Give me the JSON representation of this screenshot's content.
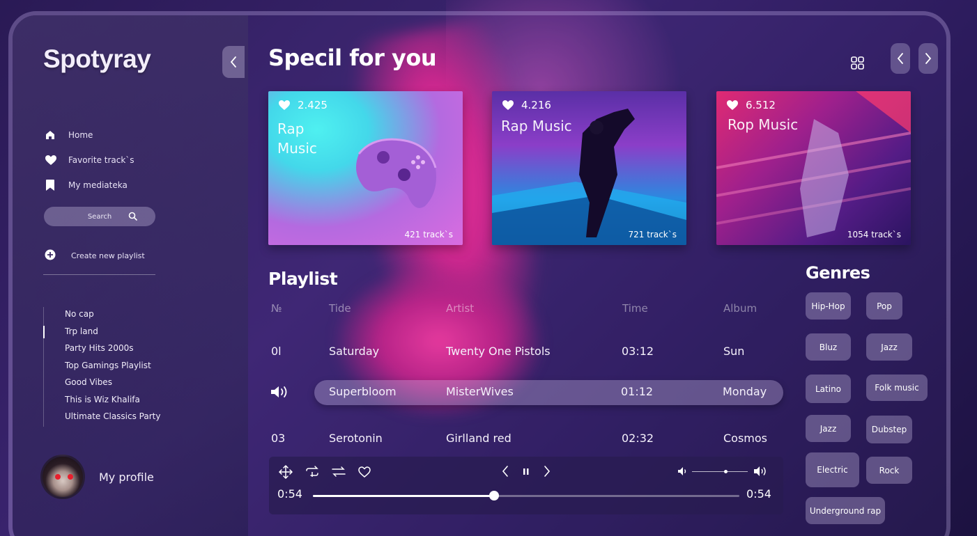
{
  "app": {
    "logo": "Spotyray"
  },
  "nav": [
    {
      "label": "Home",
      "icon": "home-icon"
    },
    {
      "label": "Favorite track`s",
      "icon": "heart-icon"
    },
    {
      "label": "My mediateka",
      "icon": "bookmark-icon"
    }
  ],
  "search": {
    "placeholder": "Search"
  },
  "create_playlist": "Create new playlist",
  "playlists": [
    "No cap",
    "Trp land",
    "Party Hits 2000s",
    "Top Gamings Playlist",
    "Good Vibes",
    "This is Wiz Khalifa",
    "Ultimate Classics Party"
  ],
  "active_playlist": "Trp land",
  "profile": {
    "label": "My profile"
  },
  "main": {
    "title": "Specil for you"
  },
  "cards": [
    {
      "likes": "2.425",
      "title_lines": [
        "Rap",
        "Music"
      ],
      "tracks": "421 track`s"
    },
    {
      "likes": "4.216",
      "title_lines": [
        "Rap Music"
      ],
      "tracks": "721 track`s"
    },
    {
      "likes": "6.512",
      "title_lines": [
        "Rop Music"
      ],
      "tracks": "1054 track`s"
    }
  ],
  "playlist": {
    "title": "Playlist",
    "headers": {
      "no": "№",
      "title": "Tide",
      "artist": "Artist",
      "time": "Time",
      "album": "Album"
    },
    "rows": [
      {
        "no": "0l",
        "title": "Saturday",
        "artist": "Twenty One Pistols",
        "time": "03:12",
        "album": "Sun"
      },
      {
        "no": "",
        "title": "Superbloom",
        "artist": "MisterWives",
        "time": "01:12",
        "album": "Monday",
        "playing": true
      },
      {
        "no": "03",
        "title": "Serotonin",
        "artist": "Girlland red",
        "time": "02:32",
        "album": "Cosmos"
      }
    ]
  },
  "genres": {
    "title": "Genres",
    "items": [
      "Hip-Hop",
      "Pop",
      "Bluz",
      "Jazz",
      "Latino",
      "Folk music",
      "Jazz",
      "Dubstep",
      "Electric",
      "Rock",
      "Underground rap"
    ]
  },
  "player": {
    "elapsed": "0:54",
    "total": "0:54",
    "progress": 0.425,
    "volume": 0.6
  },
  "colors": {
    "accent": "#ff2f9a",
    "background": "#2a1a55"
  }
}
